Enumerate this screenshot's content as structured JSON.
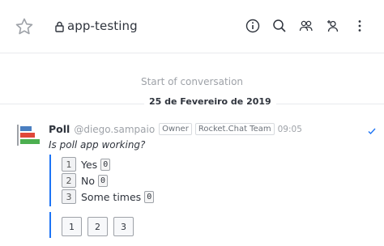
{
  "header": {
    "room_name": "app-testing",
    "icons": [
      "star-icon",
      "lock-icon",
      "info-icon",
      "search-icon",
      "members-icon",
      "add-user-icon",
      "kebab-menu-icon"
    ]
  },
  "timeline": {
    "start_label": "Start of conversation",
    "date_label": "25 de Fevereiro de 2019"
  },
  "message": {
    "author": "Poll",
    "username": "@diego.sampaio",
    "roles": [
      "Owner",
      "Rocket.Chat Team"
    ],
    "time": "09:05",
    "question": "Is poll app working?",
    "options": [
      {
        "number": "1",
        "label": "Yes",
        "votes": "0"
      },
      {
        "number": "2",
        "label": "No",
        "votes": "0"
      },
      {
        "number": "3",
        "label": "Some times",
        "votes": "0"
      }
    ],
    "vote_buttons": [
      "1",
      "2",
      "3"
    ]
  },
  "colors": {
    "accent": "#1d74f5",
    "avatar_blue": "#4a7fc1",
    "avatar_red": "#e0473a",
    "avatar_green": "#4caf50"
  }
}
